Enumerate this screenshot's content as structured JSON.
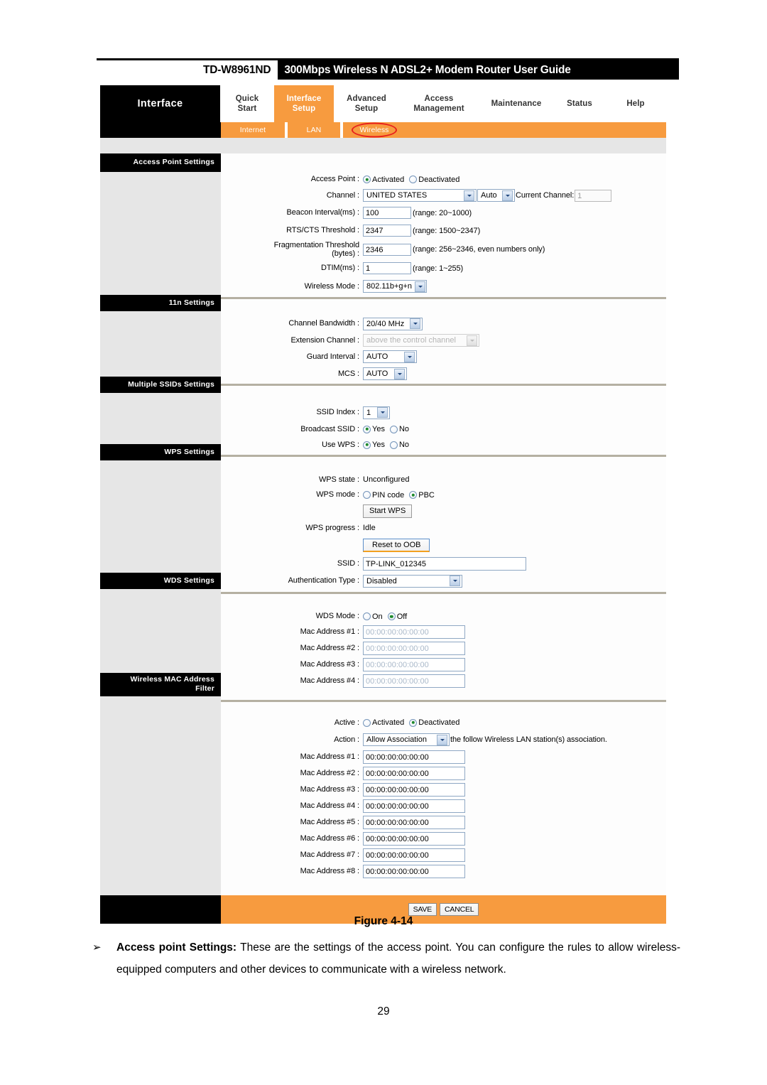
{
  "document": {
    "model": "TD-W8961ND",
    "title": "300Mbps Wireless N ADSL2+ Modem Router User Guide",
    "figure_caption": "Figure 4-14",
    "page_number": "29",
    "bullet_glyph": "➢",
    "paragraph_bold": "Access point Settings:",
    "paragraph_text": " These are the settings of the access point. You can configure the rules to allow wireless-equipped computers and other devices to communicate with a wireless network."
  },
  "colors": {
    "accent_orange": "#F79B3F",
    "panel_black": "#000000",
    "sidebar_gray": "#e6e6e6",
    "divider": "#b5b0a2",
    "highlight_red": "#e8201c",
    "radio_green": "#1f8a2e"
  },
  "nav": {
    "brand": "Interface",
    "tabs": [
      {
        "line1": "Quick",
        "line2": "Start",
        "active": false
      },
      {
        "line1": "Interface",
        "line2": "Setup",
        "active": true
      },
      {
        "line1": "Advanced",
        "line2": "Setup",
        "active": false
      },
      {
        "line1": "Access",
        "line2": "Management",
        "active": false
      },
      {
        "line1": "Maintenance",
        "line2": "",
        "active": false
      },
      {
        "line1": "Status",
        "line2": "",
        "active": false
      },
      {
        "line1": "Help",
        "line2": "",
        "active": false
      }
    ],
    "subtabs": [
      {
        "label": "Internet",
        "highlighted": false
      },
      {
        "label": "LAN",
        "highlighted": false
      },
      {
        "label": "Wireless",
        "highlighted": true
      }
    ]
  },
  "sections": {
    "access_point": {
      "label": "Access Point Settings",
      "access_point_label": "Access Point :",
      "access_point_options": [
        {
          "label": "Activated",
          "selected": true
        },
        {
          "label": "Deactivated",
          "selected": false
        }
      ],
      "channel_label": "Channel :",
      "channel_country": "UNITED STATES",
      "channel_mode": "Auto",
      "current_channel_label": "Current Channel:",
      "current_channel_value": "1",
      "beacon_label": "Beacon Interval(ms) :",
      "beacon_value": "100",
      "beacon_hint": "(range: 20~1000)",
      "rts_label": "RTS/CTS Threshold :",
      "rts_value": "2347",
      "rts_hint": "(range: 1500~2347)",
      "frag_label_line1": "Fragmentation Threshold",
      "frag_label_line2": "(bytes) :",
      "frag_value": "2346",
      "frag_hint": "(range: 256~2346, even numbers only)",
      "dtim_label": "DTIM(ms) :",
      "dtim_value": "1",
      "dtim_hint": "(range: 1~255)",
      "wireless_mode_label": "Wireless Mode :",
      "wireless_mode_value": "802.11b+g+n"
    },
    "eleven_n": {
      "label": "11n Settings",
      "channel_bandwidth_label": "Channel Bandwidth :",
      "channel_bandwidth_value": "20/40 MHz",
      "extension_channel_label": "Extension Channel :",
      "extension_channel_value": "above the control channel",
      "guard_interval_label": "Guard Interval :",
      "guard_interval_value": "AUTO",
      "mcs_label": "MCS :",
      "mcs_value": "AUTO"
    },
    "multiple_ssids": {
      "label": "Multiple SSIDs Settings",
      "ssid_index_label": "SSID Index :",
      "ssid_index_value": "1",
      "broadcast_ssid_label": "Broadcast SSID :",
      "broadcast_ssid_options": [
        {
          "label": "Yes",
          "selected": true
        },
        {
          "label": "No",
          "selected": false
        }
      ],
      "use_wps_label": "Use WPS :",
      "use_wps_options": [
        {
          "label": "Yes",
          "selected": true
        },
        {
          "label": "No",
          "selected": false
        }
      ]
    },
    "wps": {
      "label": "WPS Settings",
      "wps_state_label": "WPS state :",
      "wps_state_value": "Unconfigured",
      "wps_mode_label": "WPS mode :",
      "wps_mode_options": [
        {
          "label": "PIN code",
          "selected": false
        },
        {
          "label": "PBC",
          "selected": true
        }
      ],
      "start_wps_button": "Start WPS",
      "wps_progress_label": "WPS progress :",
      "wps_progress_value": "Idle",
      "reset_oob_button": "Reset to OOB",
      "ssid_label": "SSID :",
      "ssid_value": "TP-LINK_012345",
      "auth_type_label": "Authentication Type :",
      "auth_type_value": "Disabled"
    },
    "wds": {
      "label": "WDS Settings",
      "wds_mode_label": "WDS Mode :",
      "wds_mode_options": [
        {
          "label": "On",
          "selected": false
        },
        {
          "label": "Off",
          "selected": true
        }
      ],
      "mac_rows": [
        {
          "label": "Mac Address #1 :",
          "value": "00:00:00:00:00:00"
        },
        {
          "label": "Mac Address #2 :",
          "value": "00:00:00:00:00:00"
        },
        {
          "label": "Mac Address #3 :",
          "value": "00:00:00:00:00:00"
        },
        {
          "label": "Mac Address #4 :",
          "value": "00:00:00:00:00:00"
        }
      ]
    },
    "mac_filter": {
      "label_line1": "Wireless MAC Address",
      "label_line2": "Filter",
      "active_label": "Active :",
      "active_options": [
        {
          "label": "Activated",
          "selected": false
        },
        {
          "label": "Deactivated",
          "selected": true
        }
      ],
      "action_label": "Action :",
      "action_value": "Allow Association",
      "action_hint": "the follow Wireless LAN station(s) association.",
      "mac_rows": [
        {
          "label": "Mac Address #1 :",
          "value": "00:00:00:00:00:00"
        },
        {
          "label": "Mac Address #2 :",
          "value": "00:00:00:00:00:00"
        },
        {
          "label": "Mac Address #3 :",
          "value": "00:00:00:00:00:00"
        },
        {
          "label": "Mac Address #4 :",
          "value": "00:00:00:00:00:00"
        },
        {
          "label": "Mac Address #5 :",
          "value": "00:00:00:00:00:00"
        },
        {
          "label": "Mac Address #6 :",
          "value": "00:00:00:00:00:00"
        },
        {
          "label": "Mac Address #7 :",
          "value": "00:00:00:00:00:00"
        },
        {
          "label": "Mac Address #8 :",
          "value": "00:00:00:00:00:00"
        }
      ]
    }
  },
  "footer": {
    "save_label": "SAVE",
    "cancel_label": "CANCEL"
  }
}
